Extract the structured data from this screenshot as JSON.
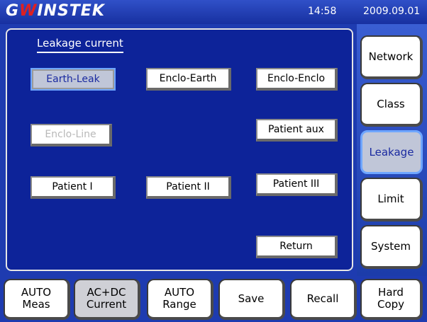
{
  "header": {
    "logo": "GWINSTEK",
    "time": "14:58",
    "date": "2009.09.01"
  },
  "panel": {
    "title": "Leakage current",
    "buttons": {
      "earth_leak": "Earth-Leak",
      "enclo_earth": "Enclo-Earth",
      "enclo_enclo": "Enclo-Enclo",
      "enclo_line": "Enclo-Line",
      "patient_aux": "Patient aux",
      "patient_1": "Patient I",
      "patient_2": "Patient II",
      "patient_3": "Patient III",
      "return": "Return"
    }
  },
  "sidebar": {
    "items": [
      "Network",
      "Class",
      "Leakage",
      "Limit",
      "System"
    ],
    "active": "Leakage"
  },
  "bottom": {
    "auto_meas": [
      "AUTO",
      "Meas"
    ],
    "acdc_current": [
      "AC+DC",
      "Current"
    ],
    "auto_range": [
      "AUTO",
      "Range"
    ],
    "save": "Save",
    "recall": "Recall",
    "hard_copy": [
      "Hard",
      "Copy"
    ]
  },
  "colors": {
    "background": "#1e3bb0",
    "panel": "#0d2399",
    "active_highlight": "#6fa6ff"
  }
}
